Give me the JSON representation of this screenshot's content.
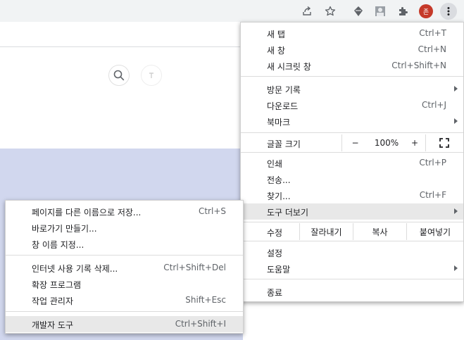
{
  "toolbar": {
    "icons": [
      "share-icon",
      "bookmark-star-icon",
      "extension-app-icon",
      "profile-thumb-icon",
      "extensions-puzzle-icon",
      "avatar",
      "more-vert-icon"
    ],
    "avatar_initial": "존"
  },
  "menu": {
    "new_tab": {
      "label": "새 탭",
      "accel": "Ctrl+T"
    },
    "new_window": {
      "label": "새 창",
      "accel": "Ctrl+N"
    },
    "new_incognito": {
      "label": "새 시크릿 창",
      "accel": "Ctrl+Shift+N"
    },
    "history": {
      "label": "방문 기록"
    },
    "downloads": {
      "label": "다운로드",
      "accel": "Ctrl+J"
    },
    "bookmarks": {
      "label": "북마크"
    },
    "zoom": {
      "label": "글꼴 크기",
      "minus": "−",
      "value": "100%",
      "plus": "+"
    },
    "print": {
      "label": "인쇄",
      "accel": "Ctrl+P"
    },
    "cast": {
      "label": "전송..."
    },
    "find": {
      "label": "찾기...",
      "accel": "Ctrl+F"
    },
    "more_tools": {
      "label": "도구 더보기"
    },
    "edit": {
      "label": "수정",
      "cut": "잘라내기",
      "copy": "복사",
      "paste": "붙여넣기"
    },
    "settings": {
      "label": "설정"
    },
    "help": {
      "label": "도움말"
    },
    "exit": {
      "label": "종료"
    }
  },
  "submenu": {
    "save_page": {
      "label": "페이지를 다른 이름으로 저장...",
      "accel": "Ctrl+S"
    },
    "create_shortcut": {
      "label": "바로가기 만들기..."
    },
    "name_window": {
      "label": "창 이름 지정..."
    },
    "clear_data": {
      "label": "인터넷 사용 기록 삭제...",
      "accel": "Ctrl+Shift+Del"
    },
    "extensions": {
      "label": "확장 프로그램"
    },
    "task_manager": {
      "label": "작업 관리자",
      "accel": "Shift+Esc"
    },
    "dev_tools": {
      "label": "개발자 도구",
      "accel": "Ctrl+Shift+I"
    }
  }
}
